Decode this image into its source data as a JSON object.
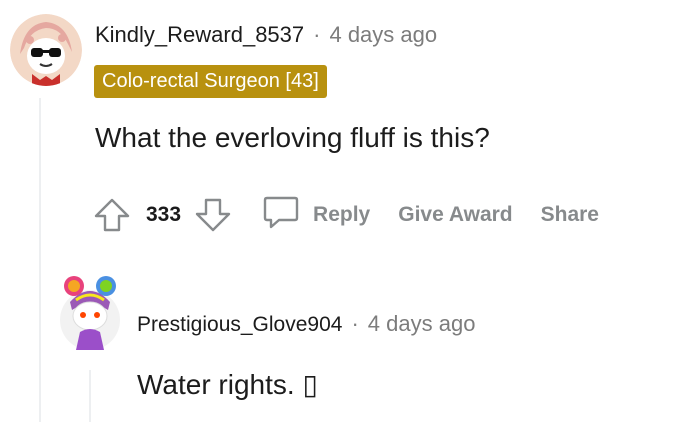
{
  "comment": {
    "username": "Kindly_Reward_8537",
    "separator": "·",
    "timestamp": "4 days ago",
    "flair": "Colo-rectal Surgeon [43]",
    "text": "What the everloving fluff is this?",
    "score": "333",
    "actions": {
      "reply": "Reply",
      "give_award": "Give Award",
      "share": "Share"
    },
    "icons": {
      "upvote": "arrow-up-icon",
      "downvote": "arrow-down-icon",
      "reply": "speech-bubble-icon"
    }
  },
  "reply": {
    "username": "Prestigious_Glove904",
    "separator": "·",
    "timestamp": "4 days ago",
    "text": "Water rights. ▯"
  },
  "colors": {
    "flair_bg": "#b8910f",
    "muted_text": "#878a8c",
    "thread_line": "#edeff1"
  }
}
